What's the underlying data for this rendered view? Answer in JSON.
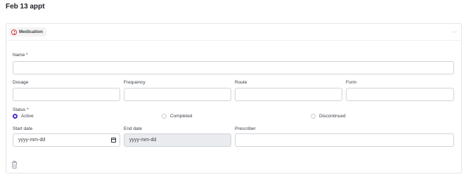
{
  "page": {
    "title": "Feb 13 appt"
  },
  "card": {
    "badge_label": "Medication",
    "more_label": "…"
  },
  "fields": {
    "name_label": "Name *",
    "dosage_label": "Dosage",
    "frequency_label": "Frequency",
    "route_label": "Route",
    "form_label": "Form",
    "status_label": "Status *",
    "start_date_label": "Start date",
    "end_date_label": "End date",
    "prescriber_label": "Prescriber",
    "start_date_placeholder": "yyyy-mm-dd",
    "end_date_placeholder": "yyyy-mm-dd"
  },
  "status_options": [
    {
      "label": "Active",
      "selected": true
    },
    {
      "label": "Completed",
      "selected": false
    },
    {
      "label": "Discontinued",
      "selected": false
    }
  ],
  "colors": {
    "accent": "#4f2ccf",
    "alert": "#d93a3a"
  }
}
